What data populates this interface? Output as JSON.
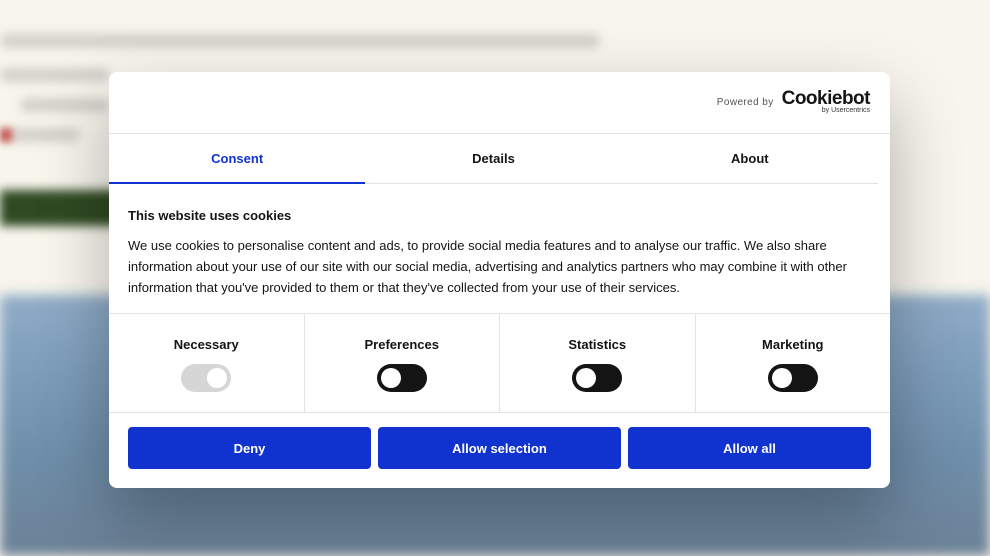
{
  "brand": {
    "powered_by": "Powered by",
    "logo_name": "Cookiebot",
    "logo_sub": "by Usercentrics",
    "accent_color": "#1032cf"
  },
  "tabs": [
    {
      "label": "Consent",
      "active": true
    },
    {
      "label": "Details",
      "active": false
    },
    {
      "label": "About",
      "active": false
    }
  ],
  "content": {
    "title": "This website uses cookies",
    "body": "We use cookies to personalise content and ads, to provide social media features and to analyse our traffic. We also share information about your use of our site with our social media, advertising and analytics partners who may combine it with other information that you've provided to them or that they've collected from your use of their services."
  },
  "categories": [
    {
      "label": "Necessary",
      "state": "on",
      "disabled": true
    },
    {
      "label": "Preferences",
      "state": "off",
      "disabled": false
    },
    {
      "label": "Statistics",
      "state": "off",
      "disabled": false
    },
    {
      "label": "Marketing",
      "state": "off",
      "disabled": false
    }
  ],
  "buttons": {
    "deny": "Deny",
    "allow_selection": "Allow selection",
    "allow_all": "Allow all"
  }
}
